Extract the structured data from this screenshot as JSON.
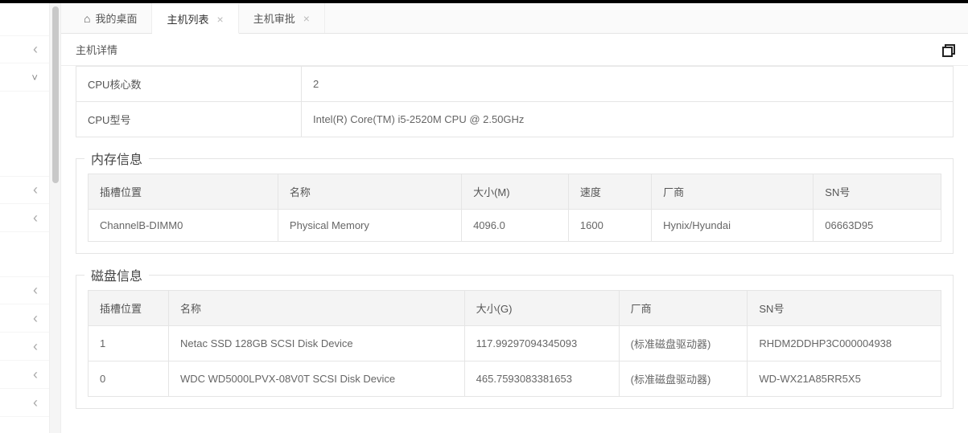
{
  "tabs": {
    "home": "我的桌面",
    "hostlist": "主机列表",
    "hostapproval": "主机审批"
  },
  "subheader": {
    "title": "主机详情"
  },
  "cpu": {
    "cores_label": "CPU核心数",
    "cores_value": "2",
    "model_label": "CPU型号",
    "model_value": "Intel(R) Core(TM) i5-2520M CPU @ 2.50GHz"
  },
  "memory": {
    "title": "内存信息",
    "headers": {
      "slot": "插槽位置",
      "name": "名称",
      "size": "大小(M)",
      "speed": "速度",
      "vendor": "厂商",
      "sn": "SN号"
    },
    "rows": [
      {
        "slot": "ChannelB-DIMM0",
        "name": "Physical Memory",
        "size": "4096.0",
        "speed": "1600",
        "vendor": "Hynix/Hyundai",
        "sn": "06663D95"
      }
    ]
  },
  "disk": {
    "title": "磁盘信息",
    "headers": {
      "slot": "插槽位置",
      "name": "名称",
      "size": "大小(G)",
      "vendor": "厂商",
      "sn": "SN号"
    },
    "rows": [
      {
        "slot": "1",
        "name": "Netac SSD 128GB SCSI Disk Device",
        "size": "117.99297094345093",
        "vendor": "(标准磁盘驱动器)",
        "sn": "RHDM2DDHP3C000004938"
      },
      {
        "slot": "0",
        "name": "WDC WD5000LPVX-08V0T SCSI Disk Device",
        "size": "465.7593083381653",
        "vendor": "(标准磁盘驱动器)",
        "sn": "WD-WX21A85RR5X5"
      }
    ]
  }
}
